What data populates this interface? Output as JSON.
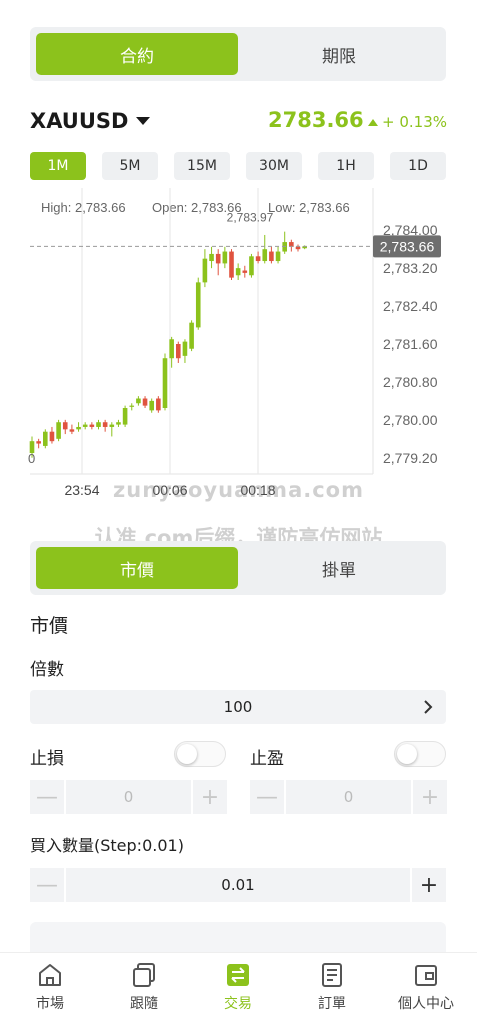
{
  "top_tabs": {
    "active": "合約",
    "inactive": "期限"
  },
  "symbol": "XAUUSD",
  "price": "2783.66",
  "change": "+ 0.13%",
  "timeframes": [
    "1M",
    "5M",
    "15M",
    "30M",
    "1H",
    "1D"
  ],
  "active_timeframe": "1M",
  "chart_info": {
    "high": "High: 2,783.66",
    "open": "Open: 2,783.66",
    "low": "Low: 2,783.66",
    "max_label": "2,783.97",
    "last_price_tag": "2,783.66"
  },
  "chart_data": {
    "type": "candlestick",
    "y_ticks": [
      "2,784.00",
      "2,783.20",
      "2,782.40",
      "2,781.60",
      "2,780.80",
      "2,780.00",
      "2,779.20"
    ],
    "y_range": [
      2778.9,
      2784.3
    ],
    "x_ticks": [
      "23:54",
      "00:06",
      "00:18"
    ],
    "left_cut_label": "0",
    "candles": [
      {
        "o": 2779.3,
        "c": 2779.55,
        "h": 2779.65,
        "l": 2779.2
      },
      {
        "o": 2779.55,
        "c": 2779.5,
        "h": 2779.6,
        "l": 2779.4
      },
      {
        "o": 2779.45,
        "c": 2779.75,
        "h": 2779.8,
        "l": 2779.4
      },
      {
        "o": 2779.75,
        "c": 2779.55,
        "h": 2779.85,
        "l": 2779.5
      },
      {
        "o": 2779.6,
        "c": 2779.95,
        "h": 2780.0,
        "l": 2779.55
      },
      {
        "o": 2779.95,
        "c": 2779.8,
        "h": 2780.0,
        "l": 2779.7
      },
      {
        "o": 2779.8,
        "c": 2779.75,
        "h": 2779.9,
        "l": 2779.7
      },
      {
        "o": 2779.8,
        "c": 2779.85,
        "h": 2779.95,
        "l": 2779.75
      },
      {
        "o": 2779.85,
        "c": 2779.9,
        "h": 2779.95,
        "l": 2779.8
      },
      {
        "o": 2779.9,
        "c": 2779.85,
        "h": 2779.95,
        "l": 2779.8
      },
      {
        "o": 2779.85,
        "c": 2779.95,
        "h": 2780.0,
        "l": 2779.8
      },
      {
        "o": 2779.95,
        "c": 2779.85,
        "h": 2780.0,
        "l": 2779.75
      },
      {
        "o": 2779.85,
        "c": 2779.9,
        "h": 2779.95,
        "l": 2779.65
      },
      {
        "o": 2779.9,
        "c": 2779.95,
        "h": 2780.0,
        "l": 2779.85
      },
      {
        "o": 2779.9,
        "c": 2780.25,
        "h": 2780.3,
        "l": 2779.85
      },
      {
        "o": 2780.3,
        "c": 2780.3,
        "h": 2780.35,
        "l": 2780.2
      },
      {
        "o": 2780.35,
        "c": 2780.45,
        "h": 2780.5,
        "l": 2780.3
      },
      {
        "o": 2780.45,
        "c": 2780.3,
        "h": 2780.5,
        "l": 2780.25
      },
      {
        "o": 2780.2,
        "c": 2780.4,
        "h": 2780.45,
        "l": 2780.15
      },
      {
        "o": 2780.45,
        "c": 2780.2,
        "h": 2780.5,
        "l": 2780.15
      },
      {
        "o": 2780.25,
        "c": 2781.3,
        "h": 2781.4,
        "l": 2780.2
      },
      {
        "o": 2781.3,
        "c": 2781.7,
        "h": 2781.75,
        "l": 2781.1
      },
      {
        "o": 2781.6,
        "c": 2781.3,
        "h": 2781.65,
        "l": 2781.2
      },
      {
        "o": 2781.35,
        "c": 2781.65,
        "h": 2781.7,
        "l": 2781.2
      },
      {
        "o": 2781.5,
        "c": 2782.05,
        "h": 2782.1,
        "l": 2781.45
      },
      {
        "o": 2781.95,
        "c": 2782.9,
        "h": 2783.0,
        "l": 2781.9
      },
      {
        "o": 2782.9,
        "c": 2783.4,
        "h": 2783.6,
        "l": 2782.8
      },
      {
        "o": 2783.35,
        "c": 2783.5,
        "h": 2783.65,
        "l": 2783.2
      },
      {
        "o": 2783.5,
        "c": 2783.3,
        "h": 2783.6,
        "l": 2783.05
      },
      {
        "o": 2783.3,
        "c": 2783.55,
        "h": 2783.65,
        "l": 2783.2
      },
      {
        "o": 2783.55,
        "c": 2783.0,
        "h": 2783.6,
        "l": 2782.95
      },
      {
        "o": 2783.05,
        "c": 2783.2,
        "h": 2783.3,
        "l": 2782.95
      },
      {
        "o": 2783.15,
        "c": 2783.1,
        "h": 2783.25,
        "l": 2783.0
      },
      {
        "o": 2783.05,
        "c": 2783.45,
        "h": 2783.5,
        "l": 2783.0
      },
      {
        "o": 2783.45,
        "c": 2783.35,
        "h": 2783.55,
        "l": 2783.3
      },
      {
        "o": 2783.35,
        "c": 2783.6,
        "h": 2783.9,
        "l": 2783.3
      },
      {
        "o": 2783.55,
        "c": 2783.35,
        "h": 2783.65,
        "l": 2783.3
      },
      {
        "o": 2783.35,
        "c": 2783.55,
        "h": 2783.65,
        "l": 2783.3
      },
      {
        "o": 2783.55,
        "c": 2783.75,
        "h": 2783.97,
        "l": 2783.5
      },
      {
        "o": 2783.75,
        "c": 2783.65,
        "h": 2783.8,
        "l": 2783.55
      },
      {
        "o": 2783.65,
        "c": 2783.6,
        "h": 2783.7,
        "l": 2783.55
      },
      {
        "o": 2783.62,
        "c": 2783.66,
        "h": 2783.68,
        "l": 2783.6
      }
    ],
    "colors": {
      "up": "#8cc21c",
      "down": "#e0533f",
      "grid": "#e6e6e6"
    }
  },
  "watermark": {
    "line1": "zunyaoyuanma.com",
    "line2": "认准.com后缀，谨防高仿网站"
  },
  "order_tabs": {
    "active": "市價",
    "inactive": "掛單"
  },
  "order_type_label": "市價",
  "multiplier": {
    "label": "倍數",
    "value": "100"
  },
  "stop_loss": {
    "label": "止損",
    "value": "0"
  },
  "take_profit": {
    "label": "止盈",
    "value": "0"
  },
  "quantity": {
    "label": "買入數量(Step:0.01)",
    "value": "0.01"
  },
  "nav": [
    {
      "label": "市場",
      "icon": "home-icon"
    },
    {
      "label": "跟隨",
      "icon": "copy-icon"
    },
    {
      "label": "交易",
      "icon": "exchange-icon",
      "active": true
    },
    {
      "label": "訂單",
      "icon": "document-icon"
    },
    {
      "label": "個人中心",
      "icon": "wallet-icon"
    }
  ]
}
